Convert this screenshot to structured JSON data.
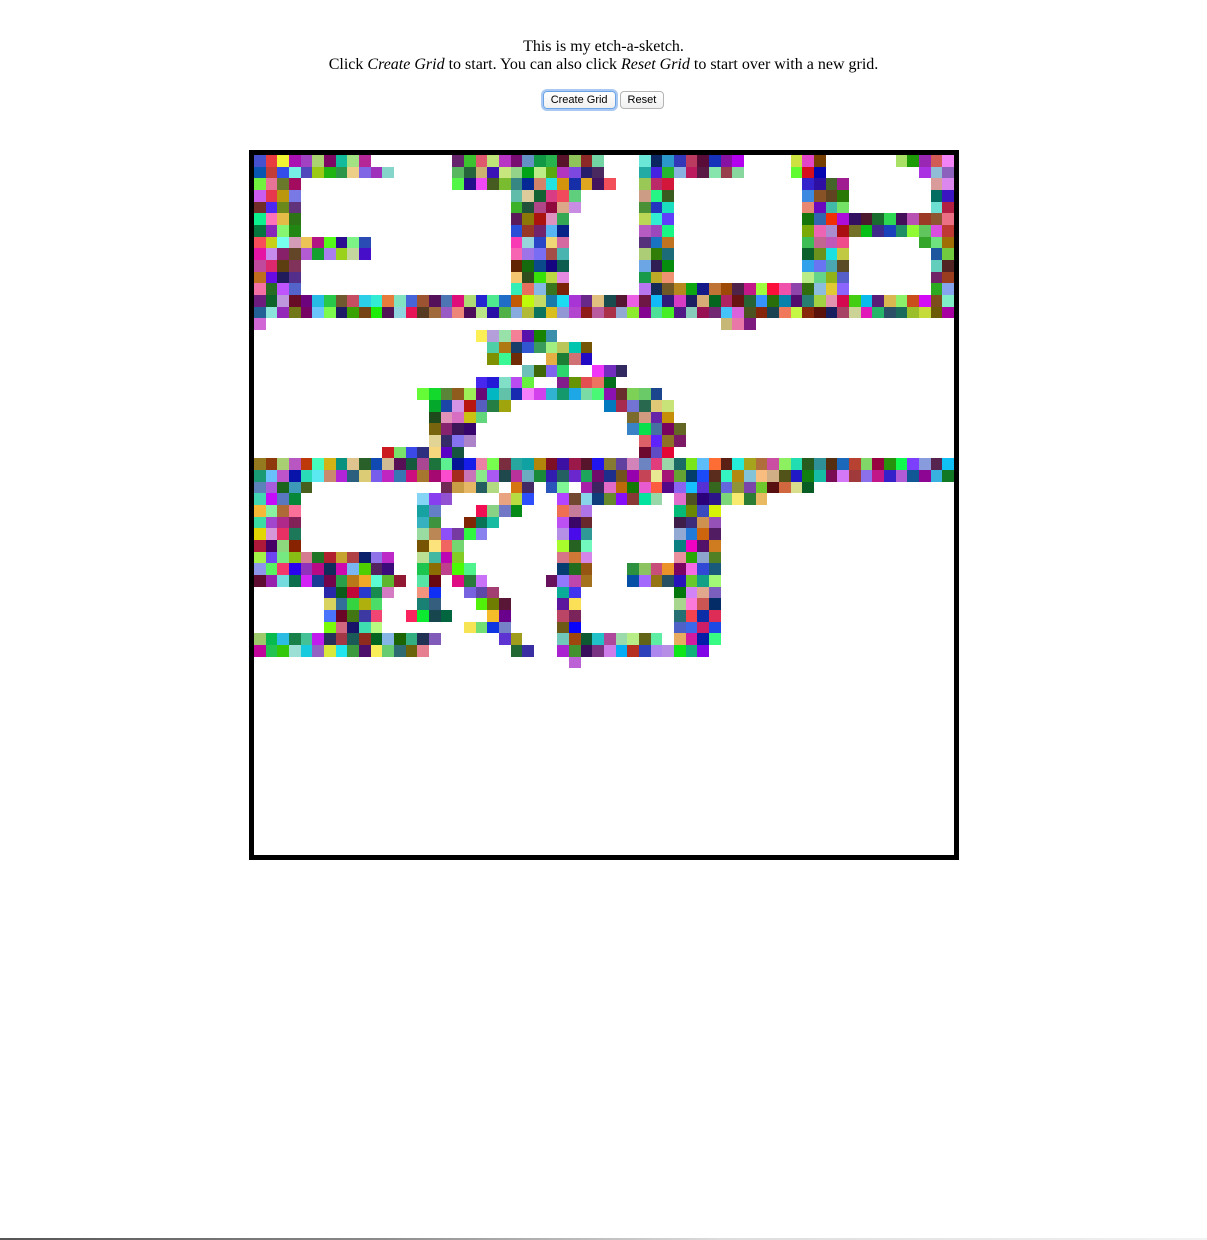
{
  "intro": {
    "line1": "This is my etch-a-sketch.",
    "line2_pre": "Click ",
    "line2_em1": "Create Grid",
    "line2_mid": " to start. You can also click ",
    "line2_em2": "Reset Grid",
    "line2_post": " to start over with a new grid."
  },
  "controls": {
    "create_label": "Create Grid",
    "reset_label": "Reset"
  },
  "grid": {
    "columns": 60,
    "rows": 60,
    "drawing_rows": [
      "XXXXXXXXXX.......XXXXXXXXXXXXX...XXXXXXXXX....XXX......XXXXX",
      "XXXXXXXXXXXX.....XXXXXXXXXXXXX...XXXXXXXXX....XXX........XXX",
      "XXXX.............XXXXXXXXXXXXXX..XXX...........XXXX.......XXX",
      "XXXX..................XXXXXX.....XXX...........XXXX.......XXX",
      "XXXX..................XXXXXX.....XXX...........XXXX.......XXX",
      "XXXX..................XXXXX......XXX...........XXXXXXXXXXXXXX",
      "XXXX..................XXXXX......XXX...........XXXXXXXXXXXXXX",
      "XXXXXXXXXX............XXXXX......XXX...........XXXX......XXXX",
      "XXXXXXXXXX............XXXXX......XXX...........XXXX.......XXX",
      "XXXX..................XXXXX......XXX...........XXXX.......XXX",
      "XXXX..................XXXXX......XXX...........XXXX.......XXX",
      "XXXX..................XXXXX......XXXXXXXXXXXXXXXXXX.......XXX",
      "XXXXXXXXXXXXXXXXXXXXXXXXXXXXXXXXXXXXXXXXXXXXXXXXXXXXXXXXXXXX",
      "XXXXXXXXXXXXXXXXXXXXXXXXXXXXXXXXXXXXXXXXXXXXXXXXXXXXXXXXXXXX",
      "X.......................................XXX.................",
      "...................XXXXXXX..........................................",
      "....................XXXXXXXXX...............................",
      "....................XXX..XXXX...............................",
      ".......................XXXX..XXX............................",
      "...................XXXXX..XXXXX.............................",
      "..............XXXXXXXXXXXXXXXXXXXXX.........................",
      "...............XXXXXXX........XXXXXX........................",
      "...............XXXXX............XXXX........................",
      "...............XXXX.............XXXXX.......................",
      "...............XXXX..............XXXX.......................",
      "...........XXXXXXX...............XXX........................",
      "XXXXXXXXXXXXXXXXXXXXXXXXXXXXXXXXXXXXXXXXXXXXXXXXXXXXXXXXXXXX",
      "XXXXXXXXXXXXXXXXXXXXXXXXXXXXXXXXXXXXXXXXXXXXXXXXXXXXXXXXXXXX",
      "XXXXX...........XXXXX.XX.XX.XXXXXXXXXXXXXXXXXXXX............",
      "XXXX..........XXX....XXX..XXXXXXXXX.XXXXXXXX................",
      "XXXX..........XX...XXXX...XXX.......XXXX....................",
      "XXXX..........XX..XXX.....XXX.......XXXX....................",
      "XXXX..........XXXXXX......XXX.......XXXX....................",
      "XXXX..........XXXX........XXX.......XXXX....................",
      "XXXXXXXXXXXX..XXXX........XXX.......XXXX....................",
      "XXXXXXXXXXXX..XXXXX.......XXX...XXXXXXXX....................",
      "XXXXXXXXXXXXX.XX.XXX.....XXXX...XXXXXXXX....................",
      "......XXXXXX..XX..XXX.....XX........XXXX....................",
      "......XXXXX...XX...XXX....XX........XXXX....................",
      "......XXXXX..XXXX...XX....XX........XXXX....................",
      "......XXXXX.......XXXX....XX........XXXX....................",
      "XXXXXXXXXXXXXXXX.....XX...XXXXXXXXX.XXXX....................",
      "XXXXXXXXXXXXXXX.......XX..XXXXXXXXXXXXX.....................",
      "...........................X................................"
    ]
  }
}
